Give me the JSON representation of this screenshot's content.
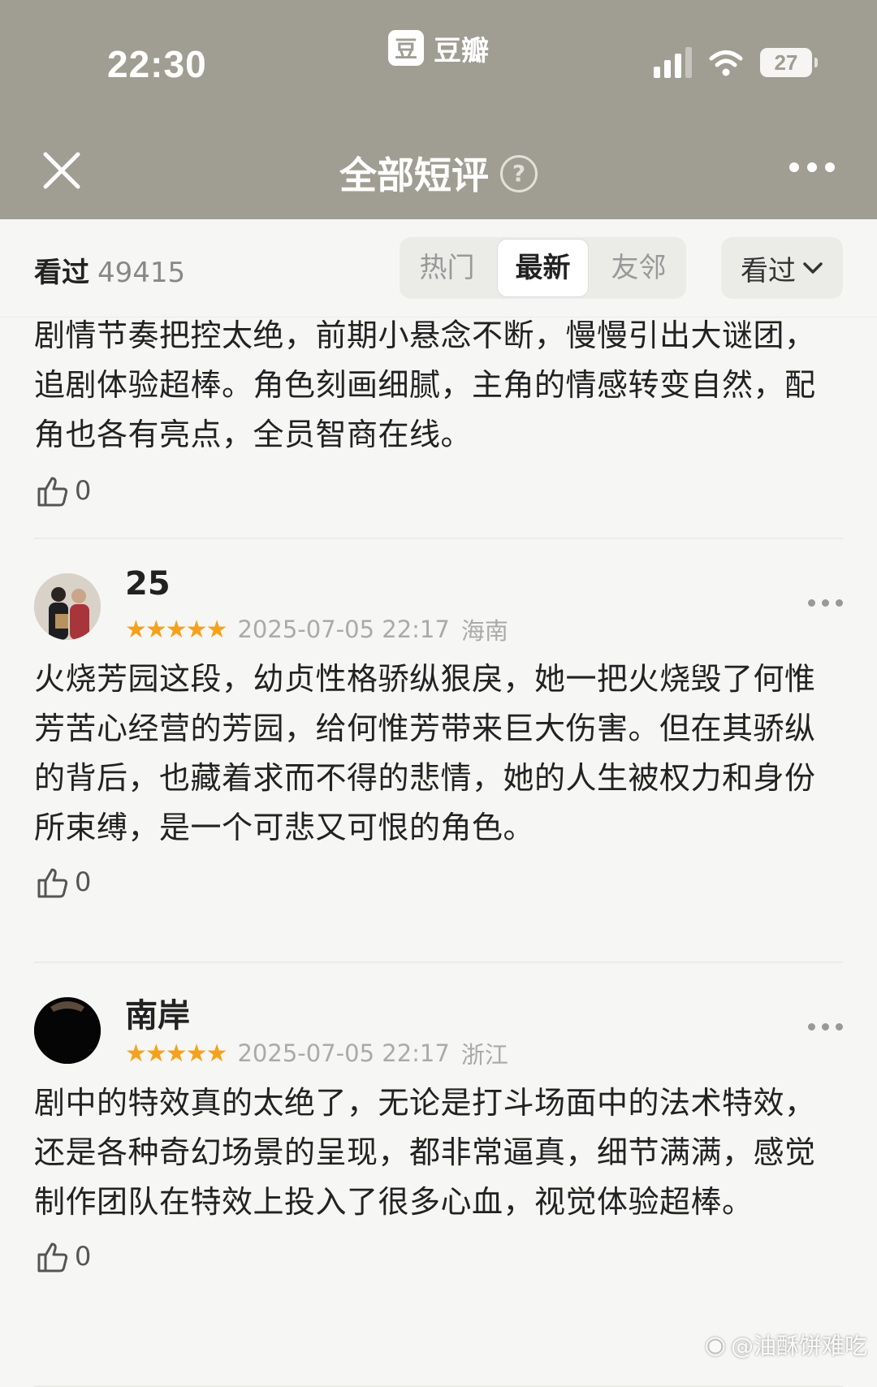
{
  "status_bar": {
    "time": "22:30",
    "app_logo_glyph": "豆",
    "app_name": "豆瓣",
    "battery": "27",
    "icons": [
      "signal-icon",
      "wifi-icon",
      "battery-icon"
    ]
  },
  "nav": {
    "title": "全部短评",
    "help_glyph": "?",
    "icons": [
      "close-icon",
      "help-icon",
      "more-icon"
    ]
  },
  "filter": {
    "seen_label": "看过",
    "seen_count": "49415",
    "tabs": [
      {
        "label": "热门",
        "active": false
      },
      {
        "label": "最新",
        "active": true
      },
      {
        "label": "友邻",
        "active": false
      }
    ],
    "dropdown_label": "看过"
  },
  "reviews": [
    {
      "user": "",
      "stars": "",
      "date": "",
      "location": "",
      "text": "剧情节奏把控太绝，前期小悬念不断，慢慢引出大谜团，追剧体验超棒。角色刻画细腻，主角的情感转变自然，配角也各有亮点，全员智商在线。",
      "likes": "0"
    },
    {
      "user": "25",
      "stars": "★★★★★",
      "date": "2025-07-05 22:17",
      "location": "海南",
      "text": "火烧芳园这段，幼贞性格骄纵狠戾，她一把火烧毁了何惟芳苦心经营的芳园，给何惟芳带来巨大伤害。但在其骄纵的背后，也藏着求而不得的悲情，她的人生被权力和身份所束缚，是一个可悲又可恨的角色。",
      "likes": "0"
    },
    {
      "user": "南岸",
      "stars": "★★★★★",
      "date": "2025-07-05 22:17",
      "location": "浙江",
      "text": "剧中的特效真的太绝了，无论是打斗场面中的法术特效，还是各种奇幻场景的呈现，都非常逼真，细节满满，感觉制作团队在特效上投入了很多心血，视觉体验超棒。",
      "likes": "0"
    }
  ],
  "watermark": "@油酥饼难吃",
  "colors": {
    "header_bg": "#a09d92",
    "page_bg": "#f6f6f4",
    "star": "#f4a21c"
  }
}
